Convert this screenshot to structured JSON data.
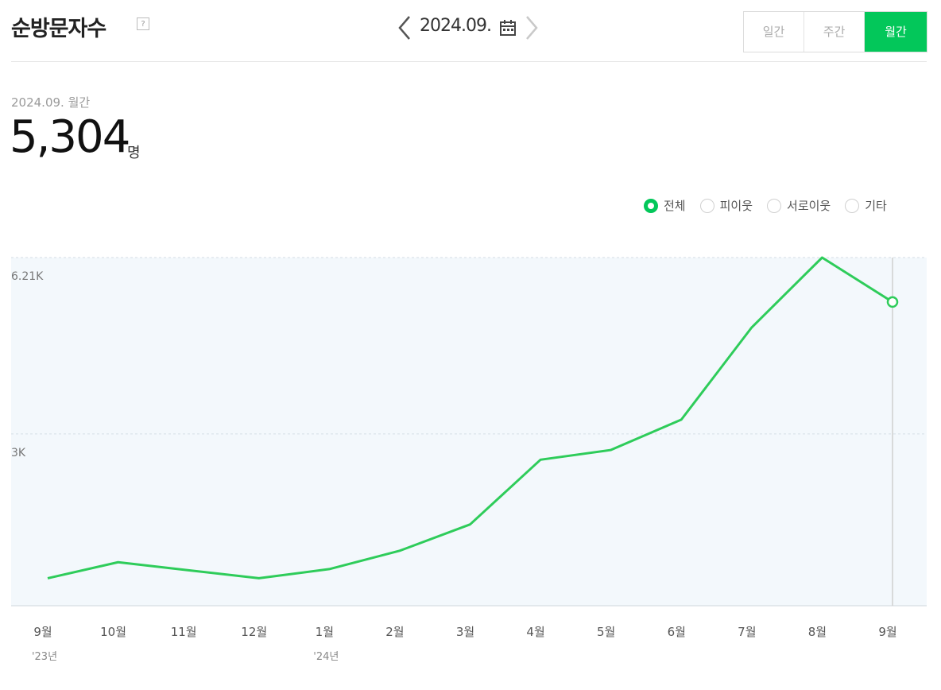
{
  "header": {
    "title": "순방문자수",
    "help_icon": "help-icon",
    "period": "2024.09.",
    "prev_icon": "chevron-left-icon",
    "next_icon": "chevron-right-icon",
    "calendar_icon": "calendar-icon"
  },
  "toggles": [
    {
      "label": "일간",
      "active": false
    },
    {
      "label": "주간",
      "active": false
    },
    {
      "label": "월간",
      "active": true
    }
  ],
  "summary": {
    "caption": "2024.09. 월간",
    "value": "5,304",
    "unit": "명"
  },
  "legend": [
    {
      "label": "전체",
      "checked": true
    },
    {
      "label": "피이웃",
      "checked": false
    },
    {
      "label": "서로이웃",
      "checked": false
    },
    {
      "label": "기타",
      "checked": false
    }
  ],
  "colors": {
    "accent": "#03c75a",
    "line": "#2ecc5a",
    "plot_bg": "#f3f8fc"
  },
  "chart_data": {
    "type": "line",
    "categories": [
      "9월",
      "10월",
      "11월",
      "12월",
      "1월",
      "2월",
      "3월",
      "4월",
      "5월",
      "6월",
      "7월",
      "8월",
      "9월"
    ],
    "year_labels": [
      "'23년",
      "",
      "",
      "",
      "'24년",
      "",
      "",
      "",
      "",
      "",
      "",
      "",
      ""
    ],
    "series": [
      {
        "values": [
          480,
          760,
          620,
          480,
          640,
          960,
          1420,
          2550,
          2720,
          3250,
          4860,
          6080,
          5304
        ]
      }
    ],
    "y_ticks": [
      {
        "value": 3000,
        "label": "3K"
      },
      {
        "value": 6210,
        "label": "6.21K"
      }
    ],
    "ylim": [
      0,
      6080
    ],
    "grid": true,
    "highlight_index": 12
  }
}
